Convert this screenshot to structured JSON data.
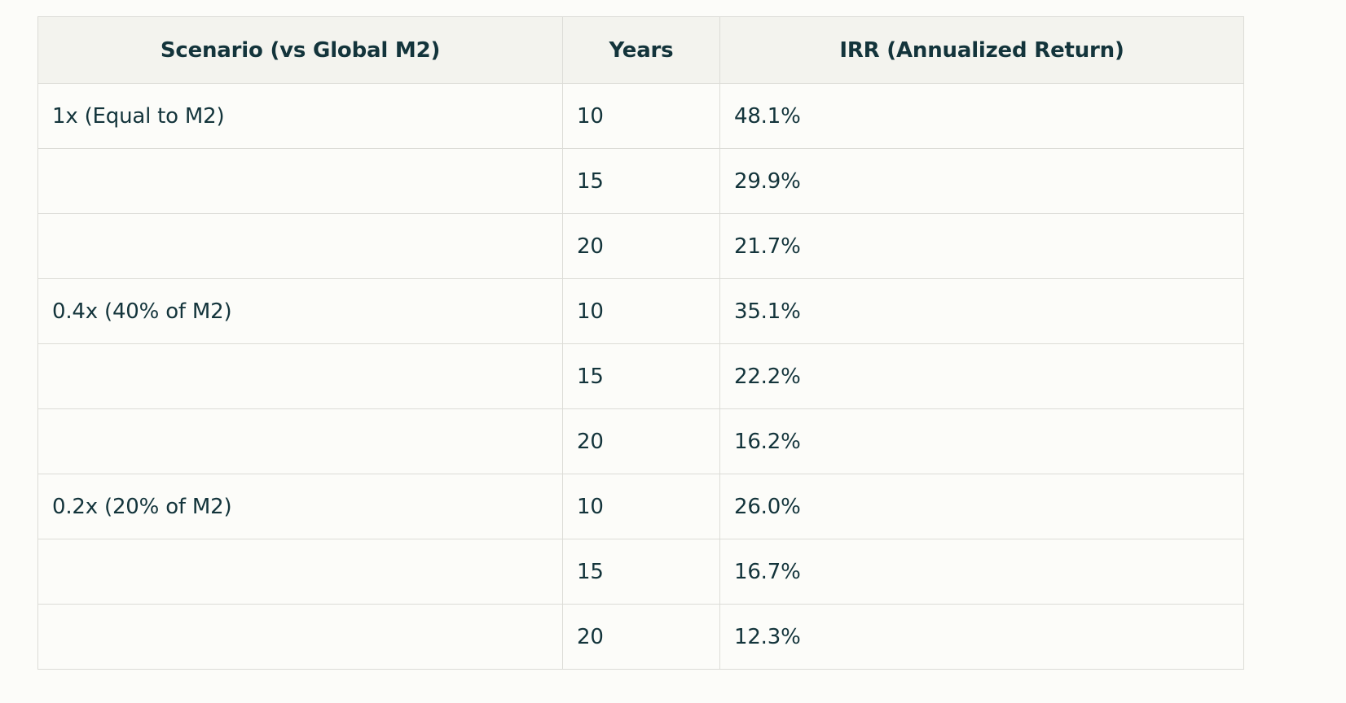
{
  "table": {
    "headers": [
      "Scenario (vs Global M2)",
      "Years",
      "IRR (Annualized Return)"
    ],
    "rows": [
      [
        "1x (Equal to M2)",
        "10",
        "48.1%"
      ],
      [
        "",
        "15",
        "29.9%"
      ],
      [
        "",
        "20",
        "21.7%"
      ],
      [
        "0.4x (40% of M2)",
        "10",
        "35.1%"
      ],
      [
        "",
        "15",
        "22.2%"
      ],
      [
        "",
        "20",
        "16.2%"
      ],
      [
        "0.2x (20% of M2)",
        "10",
        "26.0%"
      ],
      [
        "",
        "15",
        "16.7%"
      ],
      [
        "",
        "20",
        "12.3%"
      ]
    ]
  }
}
